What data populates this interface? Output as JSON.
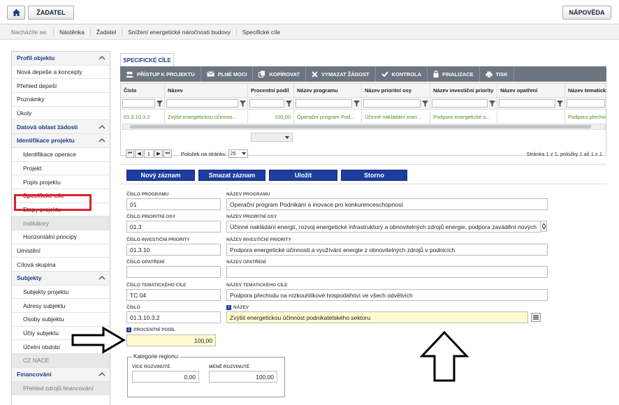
{
  "topbar": {
    "zadatel_label": "ŽADATEL",
    "help_label": "NÁPOVĚDA"
  },
  "breadcrumb": {
    "label": "Nacházíte se:",
    "items": [
      "Nástěnka",
      "Žadatel",
      "Snížení energetické náročnosti budovy",
      "Specifické cíle"
    ]
  },
  "sidebar": {
    "items": [
      {
        "label": "Profil objektu"
      },
      {
        "label": "Nová depeše a koncepty"
      },
      {
        "label": "Přehled depeší"
      },
      {
        "label": "Poznámky"
      },
      {
        "label": "Úkoly"
      },
      {
        "label": "Datová oblast žádosti"
      },
      {
        "label": "Identifikace projektu"
      },
      {
        "label": "Identifikace operace"
      },
      {
        "label": "Projekt"
      },
      {
        "label": "Popis projektu"
      },
      {
        "label": "Specifické cíle"
      },
      {
        "label": "Etapy projektu"
      },
      {
        "label": "Indikátory"
      },
      {
        "label": "Horizontální principy"
      },
      {
        "label": "Umístění"
      },
      {
        "label": "Cílová skupina"
      },
      {
        "label": "Subjekty"
      },
      {
        "label": "Subjekty projektu"
      },
      {
        "label": "Adresy subjektu"
      },
      {
        "label": "Osoby subjektu"
      },
      {
        "label": "Účty subjektu"
      },
      {
        "label": "Účetní období"
      },
      {
        "label": "CZ NACE"
      },
      {
        "label": "Financování"
      },
      {
        "label": "Přehled zdrojů financování"
      }
    ]
  },
  "main": {
    "tab_label": "SPECIFICKÉ CÍLE",
    "toolbar": [
      "PŘÍSTUP K PROJEKTU",
      "PLNÉ MOCI",
      "KOPÍROVAT",
      "VYMAZAT ŽÁDOST",
      "KONTROLA",
      "FINALIZACE",
      "TISK"
    ],
    "grid": {
      "columns": [
        "Číslo",
        "Název",
        "Procentní podíl",
        "Název programu",
        "Název prioritní osy",
        "Název investiční priority",
        "Název opatření",
        "Název tematického"
      ],
      "row": [
        "01.3.10.3.2",
        "Zvýšit energetickou účinnos...",
        "100,00",
        "Operační program Pod...",
        "Účinné nakládání ener...",
        "Podpora energetické ú...",
        "",
        "Podpora přechod"
      ]
    },
    "pager": {
      "page": "1",
      "per_page_label": "Položek na stránku",
      "per_page": "25",
      "info": "Stránka 1 z 1, položky 1 až 1 z 1"
    },
    "actions": {
      "new": "Nový záznam",
      "delete": "Smazat záznam",
      "save": "Uložit",
      "cancel": "Storno"
    },
    "form": {
      "cislo_programu_label": "Číslo programu",
      "cislo_programu": "01",
      "nazev_programu_label": "Název programu",
      "nazev_programu": "Operační program Podnikání a inovace pro konkurenceschopnost",
      "cislo_osy_label": "Číslo prioritní osy",
      "cislo_osy": "01.3",
      "nazev_osy_label": "Název prioritní osy",
      "nazev_osy": "Účinné nakládání energií, rozvoj energetické infrastruktury a obnovitelných zdrojů energie, podpora zavádění nových",
      "cislo_priority_label": "Číslo investiční priority",
      "cislo_priority": "01.3.10",
      "nazev_priority_label": "Název investiční priority",
      "nazev_priority": "Podpora energetické účinnosti a využívání energie z obnovitelných zdrojů v podnicích",
      "cislo_opatreni_label": "Číslo opatření",
      "cislo_opatreni": "",
      "nazev_opatreni_label": "Název opatření",
      "nazev_opatreni": "",
      "cislo_cile_label": "Číslo tematického cíle",
      "cislo_cile": "TC 04",
      "nazev_cile_label": "Název tematického cíle",
      "nazev_cile": "Podpora přechodu na nízkouhlíkové hospodářství ve všech odvětvích",
      "cislo_label": "Číslo",
      "cislo": "01.3.10.3.2",
      "nazev_label": "Název",
      "nazev": "Zvýšit energetickou účinnost podnikatelského sektoru",
      "podil_label": "Procentní podíl",
      "podil": "100,00",
      "kategorie_legend": "Kategorie regionu:",
      "vice_label": "Více rozvinuté",
      "vice": "0,00",
      "mene_label": "Méně rozvinuté",
      "mene": "100,00"
    }
  },
  "colors": {
    "brand_blue": "#1b3a84",
    "button_blue": "#1d3e9e",
    "toolbar_gray": "#6d7680",
    "highlight_red": "#d9232a",
    "row_green": "#4a8f1f",
    "required_yellow": "#fffbcf"
  }
}
